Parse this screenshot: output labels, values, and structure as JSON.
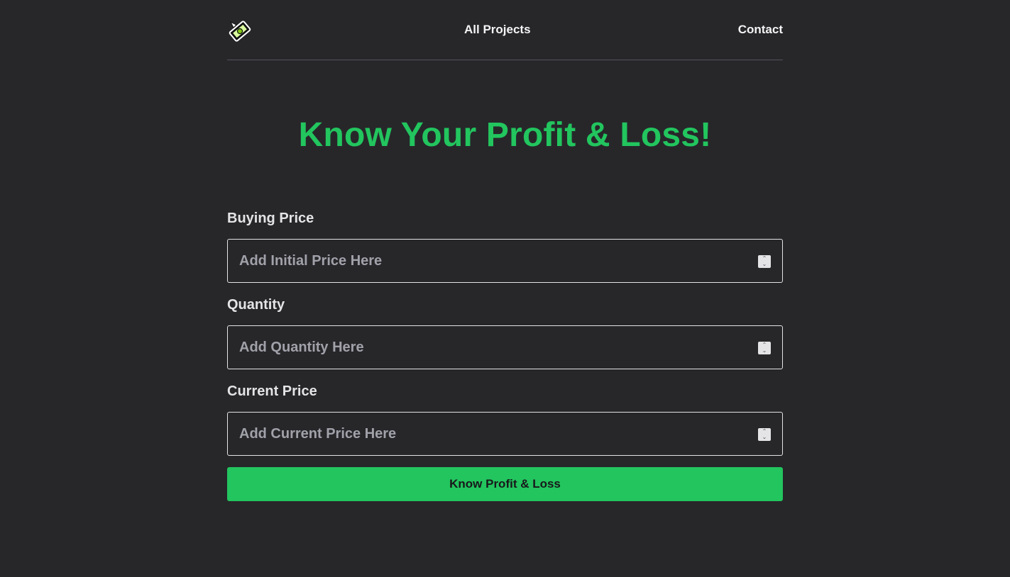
{
  "nav": {
    "logo": "money-logo-icon",
    "links": [
      "All Projects",
      "Contact"
    ]
  },
  "title": "Know Your Profit & Loss!",
  "form": {
    "fields": [
      {
        "label": "Buying Price",
        "placeholder": "Add Initial Price Here",
        "value": ""
      },
      {
        "label": "Quantity",
        "placeholder": "Add Quantity Here",
        "value": ""
      },
      {
        "label": "Current Price",
        "placeholder": "Add Current Price Here",
        "value": ""
      }
    ],
    "submit_label": "Know Profit & Loss"
  },
  "colors": {
    "background": "#27272a",
    "accent": "#22c55e",
    "text": "#f4f4f5"
  }
}
